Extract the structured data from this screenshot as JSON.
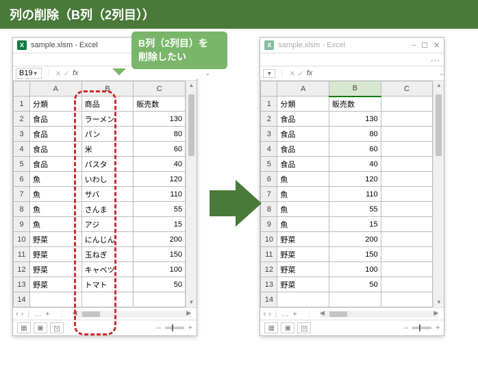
{
  "title_bar": "列の削除（B列（2列目））",
  "callout": {
    "line1": "B列（2列目）を",
    "line2": "削除したい"
  },
  "left_window": {
    "title": "sample.xlsm - Excel",
    "namebox": "B19",
    "col_headers": [
      "A",
      "B",
      "C"
    ],
    "header_row": [
      "分類",
      "商品",
      "販売数"
    ],
    "rows": [
      [
        "食品",
        "ラーメン",
        "130"
      ],
      [
        "食品",
        "パン",
        "80"
      ],
      [
        "食品",
        "米",
        "60"
      ],
      [
        "食品",
        "パスタ",
        "40"
      ],
      [
        "魚",
        "いわし",
        "120"
      ],
      [
        "魚",
        "サバ",
        "110"
      ],
      [
        "魚",
        "さんま",
        "55"
      ],
      [
        "魚",
        "アジ",
        "15"
      ],
      [
        "野菜",
        "にんじん",
        "200"
      ],
      [
        "野菜",
        "玉ねぎ",
        "150"
      ],
      [
        "野菜",
        "キャベツ",
        "100"
      ],
      [
        "野菜",
        "トマト",
        "50"
      ]
    ]
  },
  "right_window": {
    "title": "sample.xlsm - Excel",
    "namebox": "",
    "col_headers": [
      "A",
      "B",
      "C"
    ],
    "header_row": [
      "分類",
      "販売数",
      ""
    ],
    "rows": [
      [
        "食品",
        "130",
        ""
      ],
      [
        "食品",
        "80",
        ""
      ],
      [
        "食品",
        "60",
        ""
      ],
      [
        "食品",
        "40",
        ""
      ],
      [
        "魚",
        "120",
        ""
      ],
      [
        "魚",
        "110",
        ""
      ],
      [
        "魚",
        "55",
        ""
      ],
      [
        "魚",
        "15",
        ""
      ],
      [
        "野菜",
        "200",
        ""
      ],
      [
        "野菜",
        "150",
        ""
      ],
      [
        "野菜",
        "100",
        ""
      ],
      [
        "野菜",
        "50",
        ""
      ]
    ]
  },
  "icons": {
    "fx": "fx",
    "dots": "⋯",
    "min": "–",
    "max": "☐",
    "close": "✕"
  }
}
